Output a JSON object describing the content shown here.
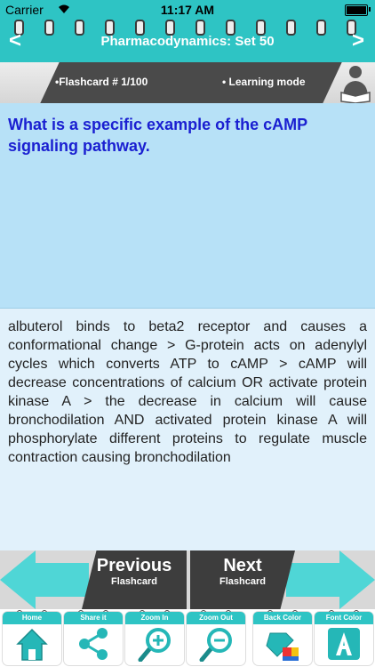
{
  "status": {
    "carrier": "Carrier",
    "time": "11:17 AM"
  },
  "header": {
    "title": "Pharmacodynamics: Set 50",
    "back": "<",
    "forward": ">"
  },
  "info": {
    "flashcard": "•Flashcard #  1/100",
    "mode": "• Learning mode"
  },
  "question": "What is a specific example of the cAMP signaling pathway.",
  "answer": "albuterol binds to beta2 receptor and causes a conformational change > G-protein acts on adenylyl cycles which converts ATP to cAMP > cAMP will decrease concentrations of calcium OR activate protein kinase A > the decrease in calcium will cause bronchodilation AND activated protein kinase A will phosphorylate different proteins to regulate muscle contraction causing bronchodilation",
  "nav": {
    "previous": {
      "big": "Previous",
      "small": "Flashcard"
    },
    "next": {
      "big": "Next",
      "small": "Flashcard"
    }
  },
  "toolbar": [
    {
      "label": "Home",
      "icon": "home-icon"
    },
    {
      "label": "Share it",
      "icon": "share-icon"
    },
    {
      "label": "Zoom In",
      "icon": "zoom-in-icon"
    },
    {
      "label": "Zoom Out",
      "icon": "zoom-out-icon"
    },
    {
      "label": "Back Color",
      "icon": "back-color-icon"
    },
    {
      "label": "Font Color",
      "icon": "font-color-icon"
    }
  ],
  "colors": {
    "accent": "#2ec4c4",
    "question_bg": "#b7e1f7",
    "question_text": "#1a1fd1",
    "answer_bg": "#e1f1fb",
    "dark": "#3d3d3d"
  }
}
